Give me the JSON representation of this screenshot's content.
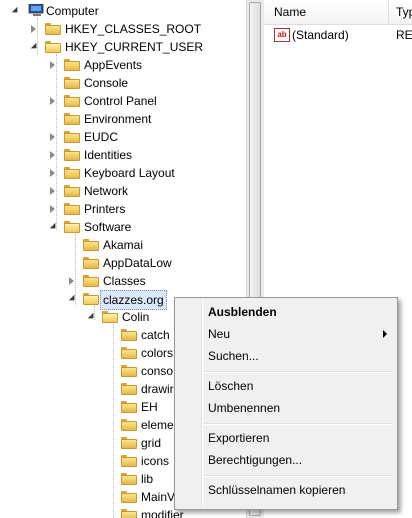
{
  "tree": {
    "root": "Computer",
    "items": [
      {
        "label": "HKEY_CLASSES_ROOT"
      },
      {
        "label": "HKEY_CURRENT_USER"
      },
      {
        "label": "AppEvents"
      },
      {
        "label": "Console"
      },
      {
        "label": "Control Panel"
      },
      {
        "label": "Environment"
      },
      {
        "label": "EUDC"
      },
      {
        "label": "Identities"
      },
      {
        "label": "Keyboard Layout"
      },
      {
        "label": "Network"
      },
      {
        "label": "Printers"
      },
      {
        "label": "Software"
      },
      {
        "label": "Akamai"
      },
      {
        "label": "AppDataLow"
      },
      {
        "label": "Classes"
      },
      {
        "label": "clazzes.org"
      },
      {
        "label": "Colin"
      },
      {
        "label": "catch"
      },
      {
        "label": "colors"
      },
      {
        "label": "conso"
      },
      {
        "label": "drawir"
      },
      {
        "label": "EH"
      },
      {
        "label": "eleme"
      },
      {
        "label": "grid"
      },
      {
        "label": "icons"
      },
      {
        "label": "lib"
      },
      {
        "label": "MainV"
      },
      {
        "label": "modifier"
      }
    ]
  },
  "list": {
    "columns": [
      "Name",
      "Typ"
    ],
    "rows": [
      {
        "name": "(Standard)",
        "type": "REG"
      }
    ],
    "icon": "string-value-icon"
  },
  "context_menu": {
    "items": [
      {
        "label": "Ausblenden",
        "bold": true
      },
      {
        "label": "Neu",
        "submenu": true
      },
      {
        "label": "Suchen..."
      },
      {
        "label": "Löschen"
      },
      {
        "label": "Umbenennen"
      },
      {
        "label": "Exportieren"
      },
      {
        "label": "Berechtigungen..."
      },
      {
        "label": "Schlüsselnamen kopieren"
      }
    ]
  },
  "colors": {
    "selection_bg": "#dbe8fb",
    "selection_border": "#6a8fd0",
    "folder": "#e6b84a"
  }
}
